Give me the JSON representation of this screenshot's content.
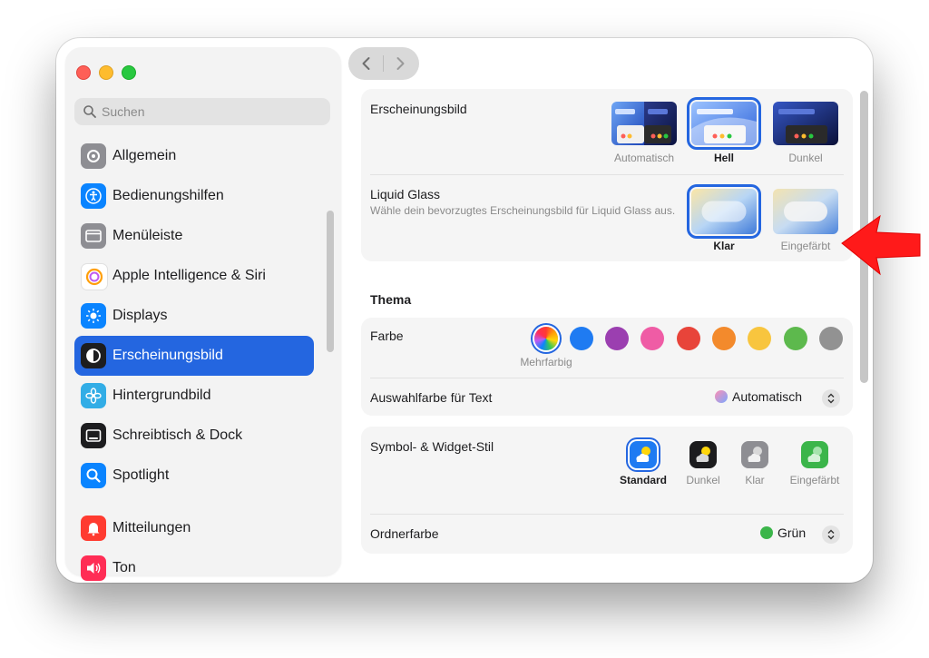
{
  "sidebar": {
    "search_placeholder": "Suchen",
    "items": [
      {
        "label": "Allgemein",
        "icon": "gear-icon",
        "color": "#8e8e93"
      },
      {
        "label": "Bedienungshilfen",
        "icon": "accessibility-icon",
        "color": "#0a84ff"
      },
      {
        "label": "Menüleiste",
        "icon": "menubar-icon",
        "color": "#8e8e93"
      },
      {
        "label": "Apple Intelligence & Siri",
        "icon": "apple-intelligence-icon",
        "color": "#ff9f0a"
      },
      {
        "label": "Displays",
        "icon": "sun-icon",
        "color": "#0a84ff"
      },
      {
        "label": "Erscheinungsbild",
        "icon": "appearance-icon",
        "color": "#1d1d1f",
        "active": true
      },
      {
        "label": "Hintergrundbild",
        "icon": "flower-icon",
        "color": "#32ade6"
      },
      {
        "label": "Schreibtisch & Dock",
        "icon": "dock-icon",
        "color": "#1d1d1f"
      },
      {
        "label": "Spotlight",
        "icon": "spotlight-icon",
        "color": "#0a84ff"
      },
      {
        "label": "Mitteilungen",
        "icon": "bell-icon",
        "color": "#ff3b30"
      },
      {
        "label": "Ton",
        "icon": "speaker-icon",
        "color": "#ff2d55"
      }
    ]
  },
  "appearance": {
    "title": "Erscheinungsbild",
    "options": [
      {
        "label": "Automatisch",
        "selected": false
      },
      {
        "label": "Hell",
        "selected": true
      },
      {
        "label": "Dunkel",
        "selected": false
      }
    ]
  },
  "liquid_glass": {
    "title": "Liquid Glass",
    "description": "Wähle dein bevorzugtes Erscheinungsbild für Liquid Glass aus.",
    "options": [
      {
        "label": "Klar",
        "selected": true
      },
      {
        "label": "Eingefärbt",
        "selected": false
      }
    ]
  },
  "theme": {
    "heading": "Thema",
    "color_label": "Farbe",
    "selected_color_caption": "Mehrfarbig",
    "colors": [
      "multicolor",
      "#1f7bf2",
      "#9b3fb0",
      "#ef5ca5",
      "#e8443a",
      "#f38a2c",
      "#f8c53e",
      "#5db94d",
      "#929292"
    ],
    "highlight_label": "Auswahlfarbe für Text",
    "highlight_value": "Automatisch"
  },
  "icon_style": {
    "title": "Symbol- & Widget-Stil",
    "options": [
      {
        "label": "Standard",
        "selected": true
      },
      {
        "label": "Dunkel",
        "selected": false
      },
      {
        "label": "Klar",
        "selected": false
      },
      {
        "label": "Eingefärbt",
        "selected": false
      }
    ],
    "folder_label": "Ordnerfarbe",
    "folder_value": "Grün",
    "folder_color": "#3bb54a"
  },
  "accent": "#2466e0"
}
